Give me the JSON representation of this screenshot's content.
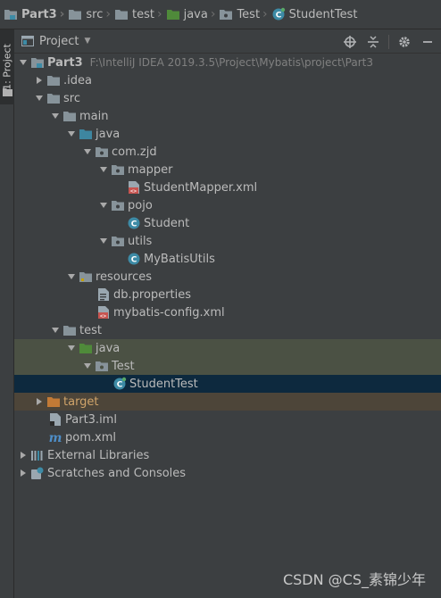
{
  "breadcrumbs": [
    "Part3",
    "src",
    "test",
    "java",
    "Test",
    "StudentTest"
  ],
  "stripe_tab": "1: Project",
  "header": {
    "title": "Project"
  },
  "tree": {
    "part3": "Part3",
    "part3_path": "F:\\IntelliJ IDEA 2019.3.5\\Project\\Mybatis\\project\\Part3",
    "idea": ".idea",
    "src": "src",
    "main": "main",
    "main_java": "java",
    "com_zjd": "com.zjd",
    "mapper": "mapper",
    "student_mapper_xml": "StudentMapper.xml",
    "pojo": "pojo",
    "student": "Student",
    "utils": "utils",
    "mybatis_utils": "MyBatisUtils",
    "resources": "resources",
    "db_properties": "db.properties",
    "mybatis_config": "mybatis-config.xml",
    "test": "test",
    "test_java": "java",
    "test_pkg": "Test",
    "student_test": "StudentTest",
    "target": "target",
    "part3_iml": "Part3.iml",
    "pom_xml": "pom.xml",
    "external_libraries": "External Libraries",
    "scratches": "Scratches and Consoles"
  },
  "watermark": "CSDN @CS_素锦少年",
  "colors": {
    "background": "#3c3f41",
    "selection": "#0d293e",
    "selection_path": "#4b5144",
    "excluded_row": "#4d4539",
    "folder": "#87939a",
    "source_folder": "#3e86a0",
    "test_folder": "#4f8a3a",
    "excluded_folder": "#c27a36",
    "class_icon": "#3d8ba6"
  },
  "icons": [
    "folder-icon",
    "module-folder-icon",
    "package-icon",
    "xml-file-icon",
    "class-icon",
    "test-class-icon",
    "properties-file-icon",
    "iml-file-icon",
    "maven-icon",
    "libraries-icon",
    "scratches-icon",
    "locate-icon",
    "collapse-all-icon",
    "gear-icon",
    "hide-icon"
  ]
}
